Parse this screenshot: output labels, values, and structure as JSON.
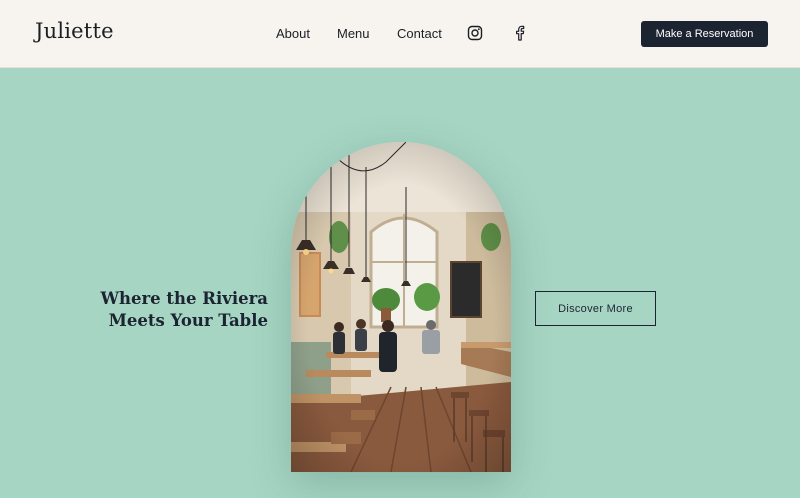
{
  "brand": {
    "name": "Juliette"
  },
  "nav": {
    "items": [
      {
        "label": "About"
      },
      {
        "label": "Menu"
      },
      {
        "label": "Contact"
      }
    ],
    "social": [
      {
        "icon": "instagram-icon"
      },
      {
        "icon": "facebook-icon"
      }
    ],
    "cta_label": "Make a Reservation"
  },
  "hero": {
    "title_line1": "Where the Riviera",
    "title_line2": "Meets Your Table",
    "button_label": "Discover More"
  },
  "colors": {
    "background": "#a7d5c4",
    "header_bg": "#f7f4ef",
    "primary_dark": "#1d2431"
  }
}
